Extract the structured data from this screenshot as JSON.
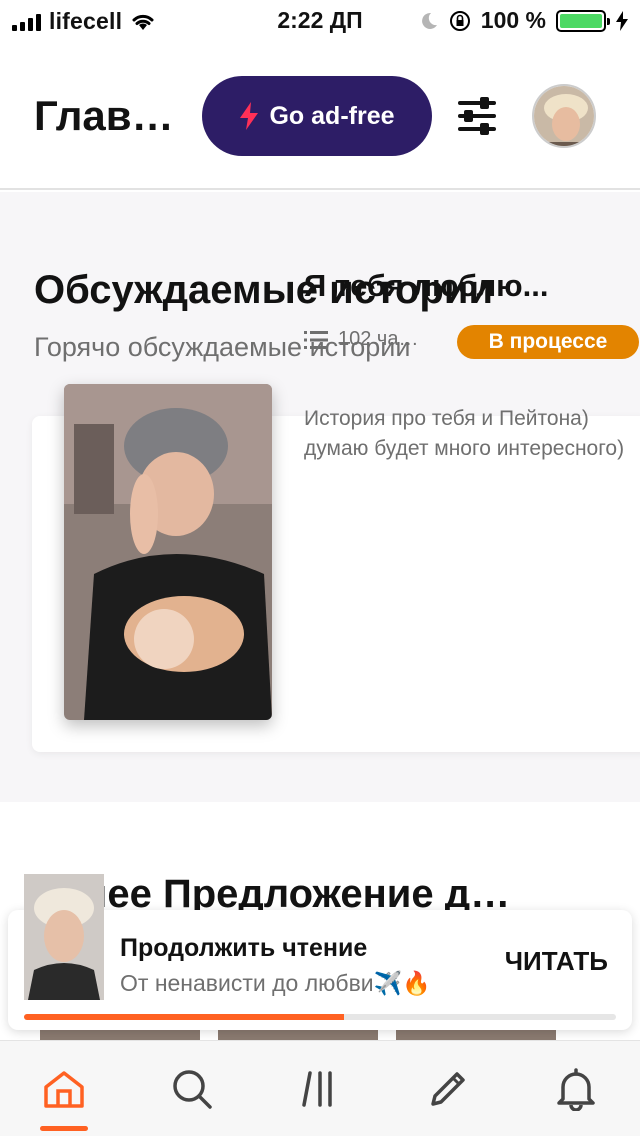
{
  "status_bar": {
    "carrier": "lifecell",
    "time": "2:22 ДП",
    "battery_percent": "100 %"
  },
  "header": {
    "title": "Глав…",
    "ad_free_label": "Go ad-free"
  },
  "discussed": {
    "title": "Обсуждаемые истории",
    "subtitle": "Горячо обсуждаемые истории",
    "story": {
      "title": "Я тебя люблю...",
      "parts": "102 ча…",
      "status": "В процессе",
      "description": "История про тебя и Пейтона) думаю будет много интересного)"
    }
  },
  "next_section": {
    "title": "…шее Предложение д…"
  },
  "continue_reading": {
    "title": "Продолжить чтение",
    "story": "От ненависти до любви✈️🔥",
    "button": "ЧИТАТЬ",
    "progress": 0.54
  },
  "bottom_nav": {
    "items": [
      "home-icon",
      "search-icon",
      "library-icon",
      "write-icon",
      "notifications-icon"
    ],
    "active": "home-icon"
  },
  "colors": {
    "accent": "#ff6122",
    "ad_free_bg": "#2d1d66",
    "badge": "#e38400",
    "battery": "#4cd964"
  }
}
